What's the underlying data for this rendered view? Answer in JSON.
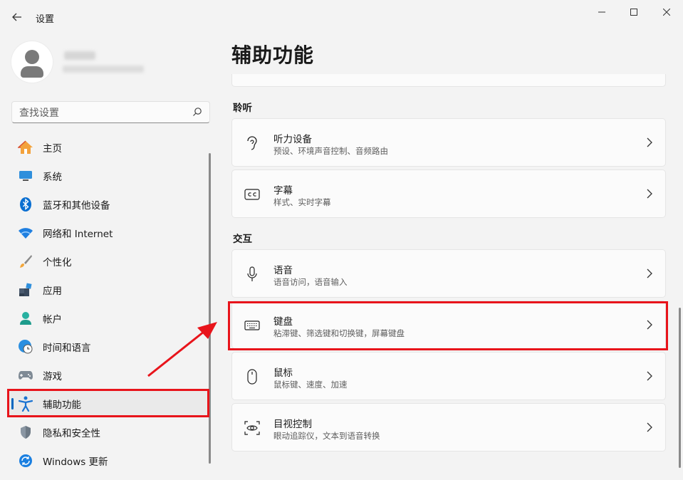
{
  "app": {
    "title": "设置"
  },
  "search": {
    "placeholder": "查找设置"
  },
  "nav": {
    "items": [
      {
        "label": "主页",
        "icon": "home-icon"
      },
      {
        "label": "系统",
        "icon": "system-icon"
      },
      {
        "label": "蓝牙和其他设备",
        "icon": "bluetooth-icon"
      },
      {
        "label": "网络和 Internet",
        "icon": "wifi-icon"
      },
      {
        "label": "个性化",
        "icon": "brush-icon"
      },
      {
        "label": "应用",
        "icon": "apps-icon"
      },
      {
        "label": "帐户",
        "icon": "account-icon"
      },
      {
        "label": "时间和语言",
        "icon": "globe-clock-icon"
      },
      {
        "label": "游戏",
        "icon": "gamepad-icon"
      },
      {
        "label": "辅助功能",
        "icon": "accessibility-icon",
        "selected": true
      },
      {
        "label": "隐私和安全性",
        "icon": "shield-icon"
      },
      {
        "label": "Windows 更新",
        "icon": "update-icon"
      }
    ]
  },
  "main": {
    "title": "辅助功能",
    "sections": [
      {
        "heading": "聆听",
        "items": [
          {
            "title": "听力设备",
            "subtitle": "预设、环境声音控制、音频路由",
            "icon": "ear-icon"
          },
          {
            "title": "字幕",
            "subtitle": "样式、实时字幕",
            "icon": "cc-icon"
          }
        ]
      },
      {
        "heading": "交互",
        "items": [
          {
            "title": "语音",
            "subtitle": "语音访问，语音输入",
            "icon": "microphone-icon"
          },
          {
            "title": "键盘",
            "subtitle": "粘滞键、筛选键和切换键，屏幕键盘",
            "icon": "keyboard-icon",
            "highlighted": true
          },
          {
            "title": "鼠标",
            "subtitle": "鼠标键、速度、加速",
            "icon": "mouse-icon"
          },
          {
            "title": "目视控制",
            "subtitle": "眼动追踪仪，文本到语音转换",
            "icon": "eye-control-icon"
          }
        ]
      }
    ]
  },
  "colors": {
    "accent": "#0067c0",
    "annotation": "#e8141b"
  }
}
